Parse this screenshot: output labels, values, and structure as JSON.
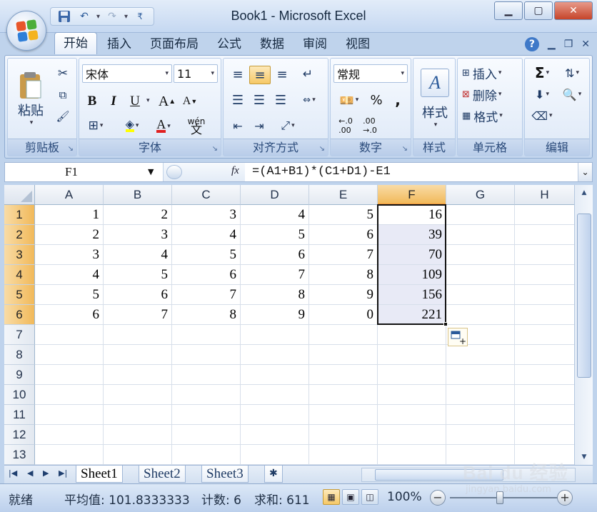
{
  "window": {
    "title": "Book1 - Microsoft Excel",
    "minimize": "▁",
    "restore": "▢",
    "close": "✕"
  },
  "qat": {
    "save_icon": "save-icon",
    "undo_icon": "undo-icon",
    "redo_icon": "redo-icon",
    "customize_icon": "customize-icon"
  },
  "tabs": [
    {
      "label": "开始",
      "active": true
    },
    {
      "label": "插入"
    },
    {
      "label": "页面布局"
    },
    {
      "label": "公式"
    },
    {
      "label": "数据"
    },
    {
      "label": "审阅"
    },
    {
      "label": "视图"
    }
  ],
  "ribbon": {
    "clipboard": {
      "group_label": "剪贴板",
      "paste_label": "粘贴"
    },
    "font": {
      "group_label": "字体",
      "font_name": "宋体",
      "font_size": "11",
      "bold": "B",
      "italic": "I",
      "underline": "U",
      "grow": "A",
      "shrink": "A",
      "font_color": "A",
      "phonetic": "wén"
    },
    "alignment": {
      "group_label": "对齐方式"
    },
    "number": {
      "group_label": "数字",
      "format": "常规",
      "percent": "%",
      "comma": ","
    },
    "styles": {
      "group_label": "样式",
      "styles_label": "样式"
    },
    "cells": {
      "group_label": "单元格",
      "insert": "插入",
      "delete": "删除",
      "format": "格式"
    },
    "editing": {
      "group_label": "编辑",
      "sum": "Σ"
    }
  },
  "formula_bar": {
    "name_box": "F1",
    "fx": "fx",
    "formula": "=(A1+B1)*(C1+D1)-E1"
  },
  "sheet": {
    "columns": [
      "A",
      "B",
      "C",
      "D",
      "E",
      "F",
      "G",
      "H"
    ],
    "selected_column": "F",
    "rows": [
      "1",
      "2",
      "3",
      "4",
      "5",
      "6",
      "7",
      "8",
      "9",
      "10",
      "11",
      "12",
      "13"
    ],
    "selected_rows": [
      "1",
      "2",
      "3",
      "4",
      "5",
      "6"
    ],
    "cells": [
      [
        "1",
        "2",
        "3",
        "4",
        "5",
        "16"
      ],
      [
        "2",
        "3",
        "4",
        "5",
        "6",
        "39"
      ],
      [
        "3",
        "4",
        "5",
        "6",
        "7",
        "70"
      ],
      [
        "4",
        "5",
        "6",
        "7",
        "8",
        "109"
      ],
      [
        "5",
        "6",
        "7",
        "8",
        "9",
        "156"
      ],
      [
        "6",
        "7",
        "8",
        "9",
        "0",
        "221"
      ]
    ]
  },
  "sheet_tabs": [
    "Sheet1",
    "Sheet2",
    "Sheet3"
  ],
  "status": {
    "ready": "就绪",
    "average": "平均值: 101.8333333",
    "count": "计数: 6",
    "sum": "求和: 611",
    "zoom": "100%"
  },
  "watermark": {
    "logo": "Bai du 经验",
    "url": "jingyan.baidu.com"
  },
  "colors": {
    "accent": "#f1b95a",
    "selection_fill": "#e8eaf6",
    "ribbon_text": "#15428b"
  }
}
